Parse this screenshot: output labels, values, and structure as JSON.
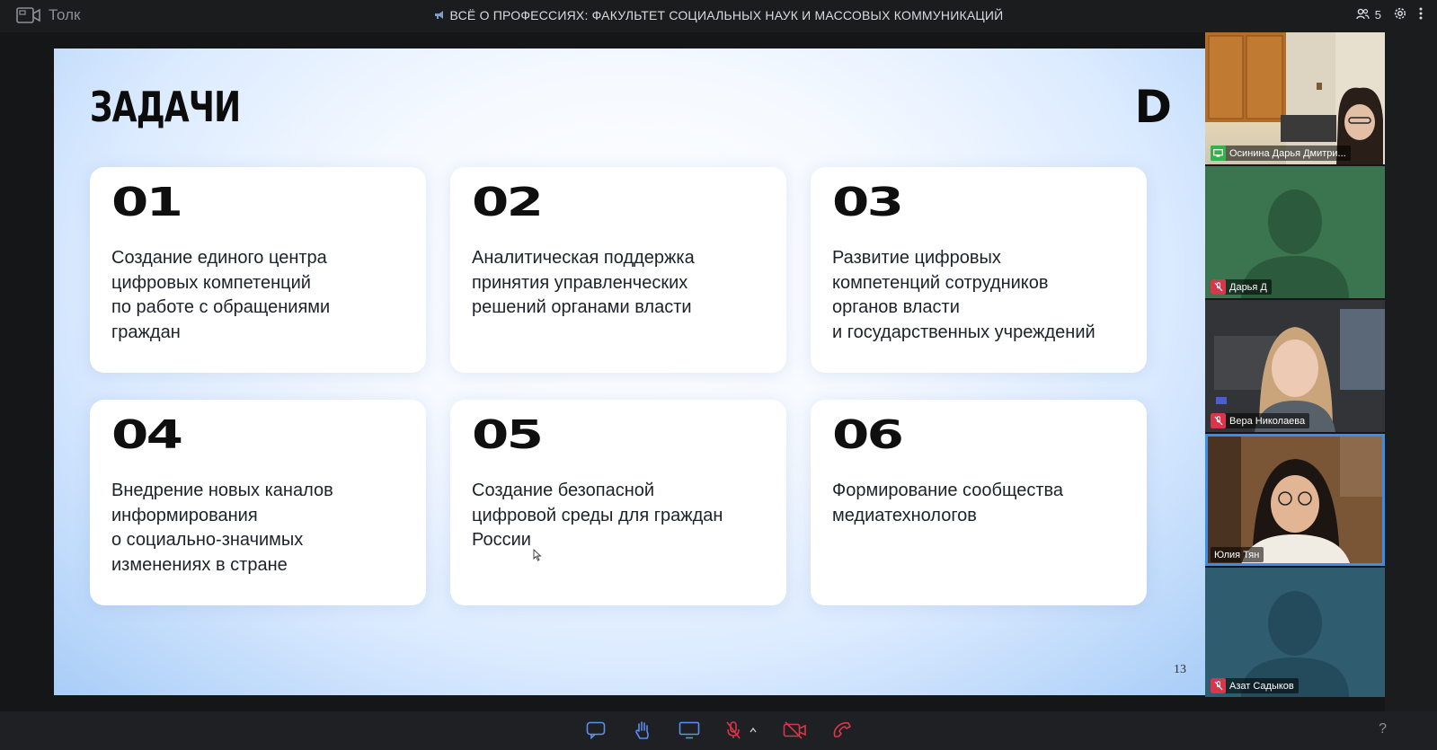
{
  "app": {
    "name": "Толк"
  },
  "meeting": {
    "title": "ВСЁ О ПРОФЕССИЯХ: ФАКУЛЬТЕТ СОЦИАЛЬНЫХ НАУК И МАССОВЫХ КОММУНИКАЦИЙ",
    "participant_count": "5"
  },
  "slide": {
    "title": "ЗАДАЧИ",
    "logo": "D",
    "page_number": "13",
    "cards": [
      {
        "num": "01",
        "text": "Создание единого центра\nцифровых компетенций\nпо работе с обращениями\nграждан"
      },
      {
        "num": "02",
        "text": "Аналитическая поддержка\nпринятия управленческих\nрешений органами власти"
      },
      {
        "num": "03",
        "text": "Развитие цифровых\nкомпетенций сотрудников\nорганов власти\nи государственных учреждений"
      },
      {
        "num": "04",
        "text": "Внедрение новых каналов\nинформирования\nо социально-значимых\nизменениях в стране"
      },
      {
        "num": "05",
        "text": "Создание безопасной\nцифровой среды для граждан\nРоссии"
      },
      {
        "num": "06",
        "text": "Формирование сообщества\nмедиатехнологов"
      }
    ]
  },
  "participants": [
    {
      "name": "Осинина Дарья Дмитри...",
      "status": "screen-share-icon",
      "color": "#2fb34a"
    },
    {
      "name": "Дарья Д",
      "status": "mic-off-icon",
      "color": "#d8364a"
    },
    {
      "name": "Вера Николаева",
      "status": "mic-off-icon",
      "color": "#d8364a"
    },
    {
      "name": "Юлия Тян",
      "status": "none",
      "active": true
    },
    {
      "name": "Азат Садыков",
      "status": "mic-off-icon",
      "color": "#d8364a"
    }
  ],
  "toolbar": {
    "items": [
      "chat-icon",
      "raise-hand-icon",
      "screen-share-icon",
      "mic-off-icon",
      "camera-off-icon",
      "hang-up-icon"
    ],
    "help": "?"
  },
  "colors": {
    "accent": "#3c8cf0",
    "muted": "#d8364a",
    "sharing": "#2fb34a",
    "tile_green": "#3b7550",
    "tile_teal": "#2f5c6e"
  }
}
